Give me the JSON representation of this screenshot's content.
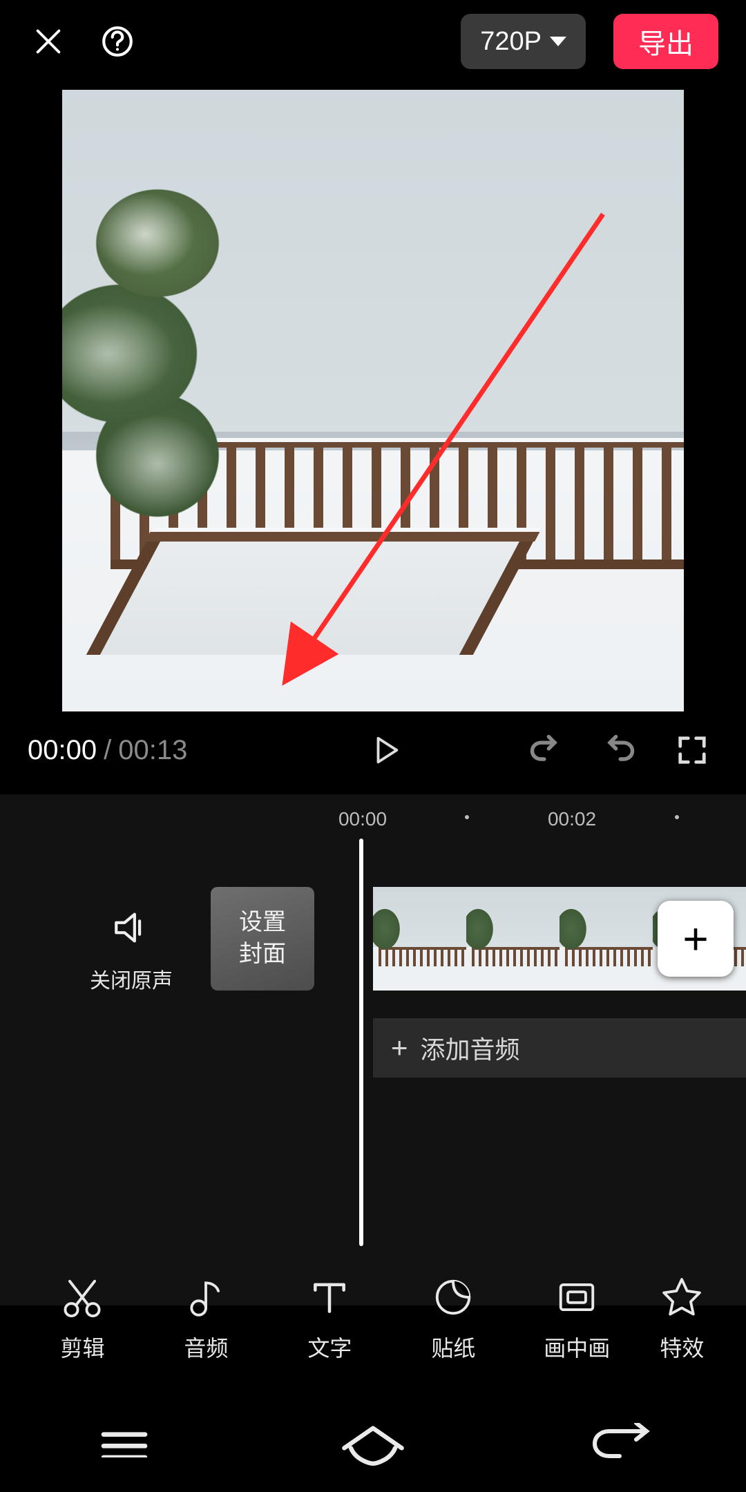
{
  "header": {
    "resolution_label": "720P",
    "export_label": "导出"
  },
  "controls": {
    "current_time": "00:00",
    "duration": "00:13",
    "separator": "/"
  },
  "ruler": {
    "ticks": [
      "00:00",
      "00:02"
    ]
  },
  "timeline": {
    "mute_label": "关闭原声",
    "cover_label": "设置\n封面",
    "add_clip_label": "+",
    "add_audio_plus": "+",
    "add_audio_label": "添加音频"
  },
  "tools": [
    {
      "id": "edit",
      "label": "剪辑",
      "icon": "scissors-icon"
    },
    {
      "id": "audio",
      "label": "音频",
      "icon": "music-note-icon"
    },
    {
      "id": "text",
      "label": "文字",
      "icon": "text-icon"
    },
    {
      "id": "sticker",
      "label": "贴纸",
      "icon": "sticker-icon"
    },
    {
      "id": "pip",
      "label": "画中画",
      "icon": "pip-icon"
    },
    {
      "id": "effect",
      "label": "特效",
      "icon": "star-icon"
    }
  ],
  "colors": {
    "accent": "#ff2c55",
    "annotation": "#ff2c2c"
  }
}
